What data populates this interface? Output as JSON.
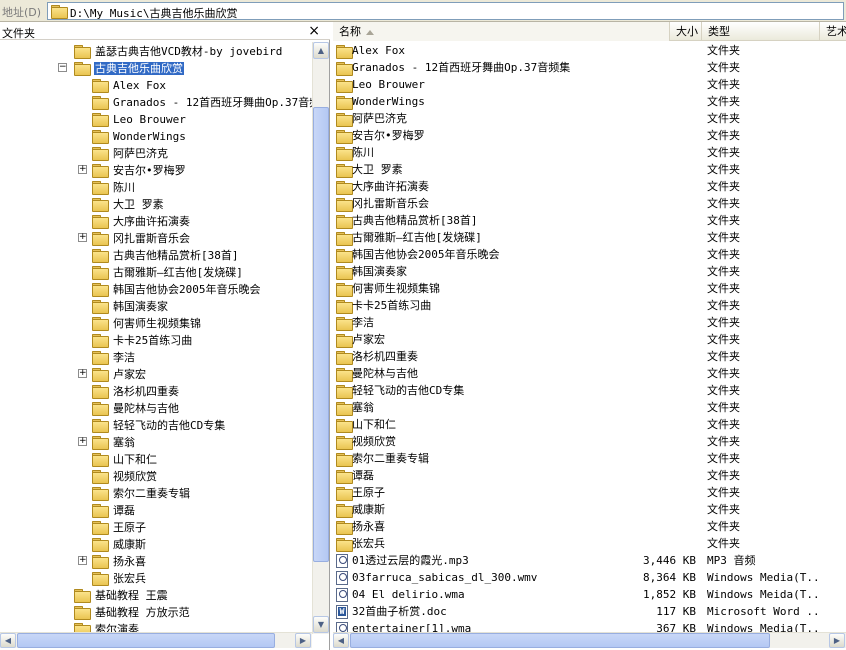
{
  "address": {
    "label": "地址(D)",
    "path": "D:\\My Music\\古典吉他乐曲欣赏"
  },
  "folders_pane": {
    "title": "文件夹",
    "close_glyph": "×",
    "items": [
      {
        "label": "盖瑟古典吉他VCD教材-by jovebird",
        "level": 0,
        "expander": ""
      },
      {
        "label": "古典吉他乐曲欣赏",
        "level": 0,
        "expander": "−",
        "selected": true
      },
      {
        "label": "Alex Fox",
        "level": 1,
        "expander": ""
      },
      {
        "label": "Granados - 12首西班牙舞曲Op.37音频",
        "level": 1,
        "expander": ""
      },
      {
        "label": "Leo Brouwer",
        "level": 1,
        "expander": ""
      },
      {
        "label": "WonderWings",
        "level": 1,
        "expander": ""
      },
      {
        "label": "阿萨巴济克",
        "level": 1,
        "expander": ""
      },
      {
        "label": "安吉尔•罗梅罗",
        "level": 1,
        "expander": "+"
      },
      {
        "label": "陈川",
        "level": 1,
        "expander": ""
      },
      {
        "label": "大卫 罗素",
        "level": 1,
        "expander": ""
      },
      {
        "label": "大序曲许拓演奏",
        "level": 1,
        "expander": ""
      },
      {
        "label": "冈扎雷斯音乐会",
        "level": 1,
        "expander": "+"
      },
      {
        "label": "古典吉他精品赏析[38首]",
        "level": 1,
        "expander": ""
      },
      {
        "label": "古爾雅斯—红吉他[发烧碟]",
        "level": 1,
        "expander": ""
      },
      {
        "label": "韩国吉他协会2005年音乐晚会",
        "level": 1,
        "expander": ""
      },
      {
        "label": "韩国演奏家",
        "level": 1,
        "expander": ""
      },
      {
        "label": "何害师生视频集锦",
        "level": 1,
        "expander": ""
      },
      {
        "label": "卡卡25首练习曲",
        "level": 1,
        "expander": ""
      },
      {
        "label": "李洁",
        "level": 1,
        "expander": ""
      },
      {
        "label": "卢家宏",
        "level": 1,
        "expander": "+"
      },
      {
        "label": "洛杉机四重奏",
        "level": 1,
        "expander": ""
      },
      {
        "label": "曼陀林与吉他",
        "level": 1,
        "expander": ""
      },
      {
        "label": "轻轻飞动的吉他CD专集",
        "level": 1,
        "expander": ""
      },
      {
        "label": "塞翁",
        "level": 1,
        "expander": "+"
      },
      {
        "label": "山下和仁",
        "level": 1,
        "expander": ""
      },
      {
        "label": "视频欣赏",
        "level": 1,
        "expander": ""
      },
      {
        "label": "索尔二重奏专辑",
        "level": 1,
        "expander": ""
      },
      {
        "label": "谭磊",
        "level": 1,
        "expander": ""
      },
      {
        "label": "王原子",
        "level": 1,
        "expander": ""
      },
      {
        "label": "威康斯",
        "level": 1,
        "expander": ""
      },
      {
        "label": "扬永喜",
        "level": 1,
        "expander": "+"
      },
      {
        "label": "张宏兵",
        "level": 1,
        "expander": ""
      },
      {
        "label": "基础教程 王震",
        "level": 0,
        "expander": ""
      },
      {
        "label": "基础教程 方放示范",
        "level": 0,
        "expander": ""
      },
      {
        "label": "索尔演奏",
        "level": 0,
        "expander": ""
      }
    ]
  },
  "file_list": {
    "columns": {
      "name": "名称",
      "size": "大小",
      "type": "类型",
      "artist": "艺术"
    },
    "rows": [
      {
        "name": "Alex Fox",
        "size": "",
        "type": "文件夹",
        "icon": "folder"
      },
      {
        "name": "Granados - 12首西班牙舞曲Op.37音频集",
        "size": "",
        "type": "文件夹",
        "icon": "folder"
      },
      {
        "name": "Leo Brouwer",
        "size": "",
        "type": "文件夹",
        "icon": "folder"
      },
      {
        "name": "WonderWings",
        "size": "",
        "type": "文件夹",
        "icon": "folder"
      },
      {
        "name": "阿萨巴济克",
        "size": "",
        "type": "文件夹",
        "icon": "folder"
      },
      {
        "name": "安吉尔•罗梅罗",
        "size": "",
        "type": "文件夹",
        "icon": "folder"
      },
      {
        "name": "陈川",
        "size": "",
        "type": "文件夹",
        "icon": "folder"
      },
      {
        "name": "大卫 罗素",
        "size": "",
        "type": "文件夹",
        "icon": "folder"
      },
      {
        "name": "大序曲许拓演奏",
        "size": "",
        "type": "文件夹",
        "icon": "folder"
      },
      {
        "name": "冈扎雷斯音乐会",
        "size": "",
        "type": "文件夹",
        "icon": "folder"
      },
      {
        "name": "古典吉他精品赏析[38首]",
        "size": "",
        "type": "文件夹",
        "icon": "folder"
      },
      {
        "name": "古爾雅斯—红吉他[发烧碟]",
        "size": "",
        "type": "文件夹",
        "icon": "folder"
      },
      {
        "name": "韩国吉他协会2005年音乐晚会",
        "size": "",
        "type": "文件夹",
        "icon": "folder"
      },
      {
        "name": "韩国演奏家",
        "size": "",
        "type": "文件夹",
        "icon": "folder"
      },
      {
        "name": "何害师生视频集锦",
        "size": "",
        "type": "文件夹",
        "icon": "folder"
      },
      {
        "name": "卡卡25首练习曲",
        "size": "",
        "type": "文件夹",
        "icon": "folder"
      },
      {
        "name": "李洁",
        "size": "",
        "type": "文件夹",
        "icon": "folder"
      },
      {
        "name": "卢家宏",
        "size": "",
        "type": "文件夹",
        "icon": "folder"
      },
      {
        "name": "洛杉机四重奏",
        "size": "",
        "type": "文件夹",
        "icon": "folder"
      },
      {
        "name": "曼陀林与吉他",
        "size": "",
        "type": "文件夹",
        "icon": "folder"
      },
      {
        "name": "轻轻飞动的吉他CD专集",
        "size": "",
        "type": "文件夹",
        "icon": "folder"
      },
      {
        "name": "塞翁",
        "size": "",
        "type": "文件夹",
        "icon": "folder"
      },
      {
        "name": "山下和仁",
        "size": "",
        "type": "文件夹",
        "icon": "folder"
      },
      {
        "name": "视频欣赏",
        "size": "",
        "type": "文件夹",
        "icon": "folder"
      },
      {
        "name": "索尔二重奏专辑",
        "size": "",
        "type": "文件夹",
        "icon": "folder"
      },
      {
        "name": "谭磊",
        "size": "",
        "type": "文件夹",
        "icon": "folder"
      },
      {
        "name": "王原子",
        "size": "",
        "type": "文件夹",
        "icon": "folder"
      },
      {
        "name": "威康斯",
        "size": "",
        "type": "文件夹",
        "icon": "folder"
      },
      {
        "name": "扬永喜",
        "size": "",
        "type": "文件夹",
        "icon": "folder"
      },
      {
        "name": "张宏兵",
        "size": "",
        "type": "文件夹",
        "icon": "folder"
      },
      {
        "name": "01透过云层的霞光.mp3",
        "size": "3,446 KB",
        "type": "MP3 音频",
        "icon": "media"
      },
      {
        "name": "03farruca_sabicas_dl_300.wmv",
        "size": "8,364 KB",
        "type": "Windows Media(T...",
        "icon": "media"
      },
      {
        "name": "04 El delirio.wma",
        "size": "1,852 KB",
        "type": "Windows Meida(T...",
        "icon": "media"
      },
      {
        "name": "32首曲子析赏.doc",
        "size": "117 KB",
        "type": "Microsoft Word ...",
        "icon": "doc"
      },
      {
        "name": "entertainer[1].wma",
        "size": "367 KB",
        "type": "Windows Media(T...",
        "icon": "media"
      }
    ]
  },
  "colors": {
    "selection": "#316ac5",
    "folder_fill": "#fbe38b",
    "scroll_thumb": "#c8d7f7"
  }
}
